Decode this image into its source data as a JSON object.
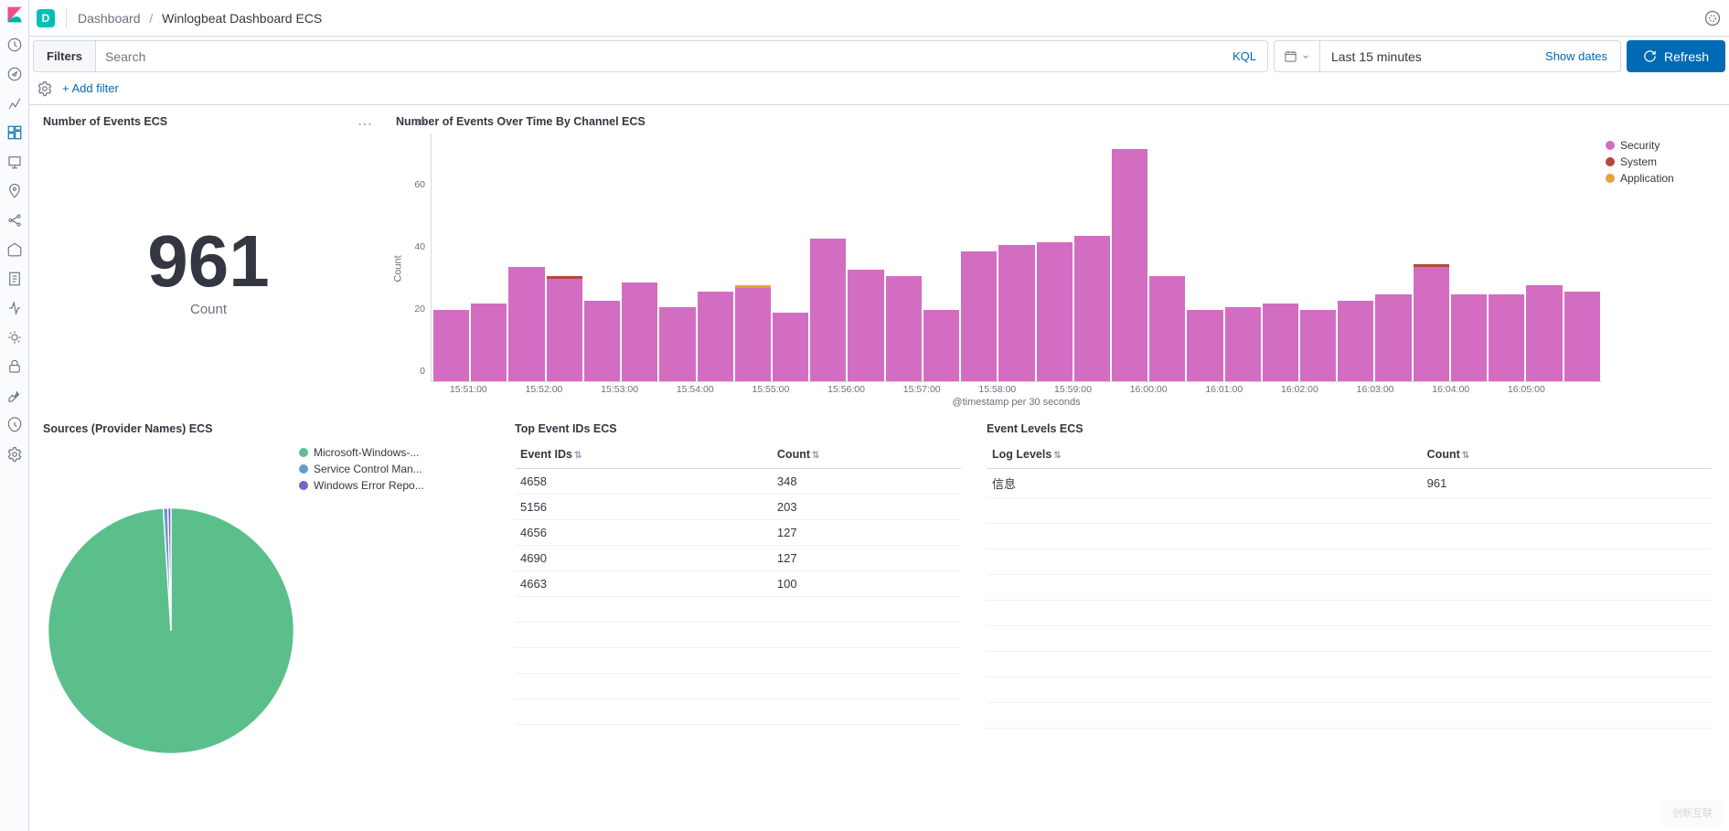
{
  "topbar": {
    "space_letter": "D",
    "bc_root": "Dashboard",
    "bc_sep": "/",
    "bc_current": "Winlogbeat Dashboard ECS"
  },
  "query": {
    "filters_label": "Filters",
    "search_placeholder": "Search",
    "kql_label": "KQL",
    "time_range": "Last 15 minutes",
    "show_dates": "Show dates",
    "refresh_label": "Refresh"
  },
  "filterrow": {
    "add_filter": "+ Add filter"
  },
  "panels": {
    "count": {
      "title": "Number of Events ECS",
      "value": "961",
      "label": "Count"
    },
    "overtime": {
      "title": "Number of Events Over Time By Channel ECS",
      "ylabel": "Count",
      "xlabel": "@timestamp per 30 seconds",
      "legend": [
        {
          "label": "Security",
          "color": "#d36dc2"
        },
        {
          "label": "System",
          "color": "#b5483b"
        },
        {
          "label": "Application",
          "color": "#e8a23a"
        }
      ]
    },
    "sources": {
      "title": "Sources (Provider Names) ECS",
      "legend": [
        {
          "label": "Microsoft-Windows-...",
          "color": "#5bbf8c"
        },
        {
          "label": "Service Control Man...",
          "color": "#6699d2"
        },
        {
          "label": "Windows Error Repo...",
          "color": "#7c5fc9"
        }
      ]
    },
    "topids": {
      "title": "Top Event IDs ECS",
      "col1": "Event IDs",
      "col2": "Count",
      "rows": [
        {
          "id": "4658",
          "count": "348"
        },
        {
          "id": "5156",
          "count": "203"
        },
        {
          "id": "4656",
          "count": "127"
        },
        {
          "id": "4690",
          "count": "127"
        },
        {
          "id": "4663",
          "count": "100"
        }
      ]
    },
    "levels": {
      "title": "Event Levels ECS",
      "col1": "Log Levels",
      "col2": "Count",
      "rows": [
        {
          "level": "信息",
          "count": "961"
        }
      ]
    }
  },
  "chart_data": {
    "type": "bar",
    "ylabel": "Count",
    "xlabel": "@timestamp per 30 seconds",
    "ylim": [
      0,
      80
    ],
    "yticks": [
      0,
      20,
      40,
      60,
      80
    ],
    "categories": [
      "15:51:00",
      "15:52:00",
      "15:53:00",
      "15:54:00",
      "15:55:00",
      "15:56:00",
      "15:57:00",
      "15:58:00",
      "15:59:00",
      "16:00:00",
      "16:01:00",
      "16:02:00",
      "16:03:00",
      "16:04:00",
      "16:05:00"
    ],
    "series": [
      {
        "name": "Security",
        "color": "#d36dc2",
        "values": [
          23,
          25,
          37,
          32,
          26,
          32,
          24,
          29,
          29,
          22,
          46,
          36,
          34,
          23,
          42,
          44,
          45,
          47,
          75,
          34,
          23,
          24,
          25,
          23,
          26,
          28,
          36,
          28,
          28,
          31,
          29
        ]
      },
      {
        "name": "System",
        "color": "#b5483b",
        "values": [
          0,
          0,
          0,
          1,
          0,
          0,
          0,
          0,
          0,
          0,
          0,
          0,
          0,
          0,
          0,
          0,
          0,
          0,
          0,
          0,
          0,
          0,
          0,
          0,
          0,
          0,
          1,
          0,
          0,
          0,
          0
        ]
      },
      {
        "name": "Application",
        "color": "#e8a23a",
        "values": [
          0,
          0,
          0,
          0,
          0,
          0,
          0,
          0,
          1,
          0,
          0,
          0,
          0,
          0,
          0,
          0,
          0,
          0,
          0,
          0,
          0,
          0,
          0,
          0,
          0,
          0,
          0,
          0,
          0,
          0,
          0
        ]
      }
    ]
  },
  "pie_data": {
    "type": "pie",
    "series": [
      {
        "name": "Microsoft-Windows-...",
        "value": 99,
        "color": "#5bbf8c"
      },
      {
        "name": "Service Control Man...",
        "value": 0.6,
        "color": "#6699d2"
      },
      {
        "name": "Windows Error Repo...",
        "value": 0.4,
        "color": "#7c5fc9"
      }
    ]
  },
  "watermark": "创新互联"
}
